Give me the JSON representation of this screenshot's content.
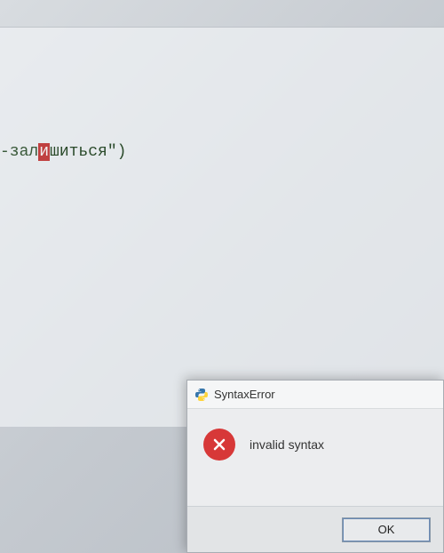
{
  "editor": {
    "code_prefix": "-зал",
    "code_highlight": "и",
    "code_suffix": "шиться\")"
  },
  "dialog": {
    "title": "SyntaxError",
    "message": "invalid syntax",
    "ok_label": "OK"
  }
}
